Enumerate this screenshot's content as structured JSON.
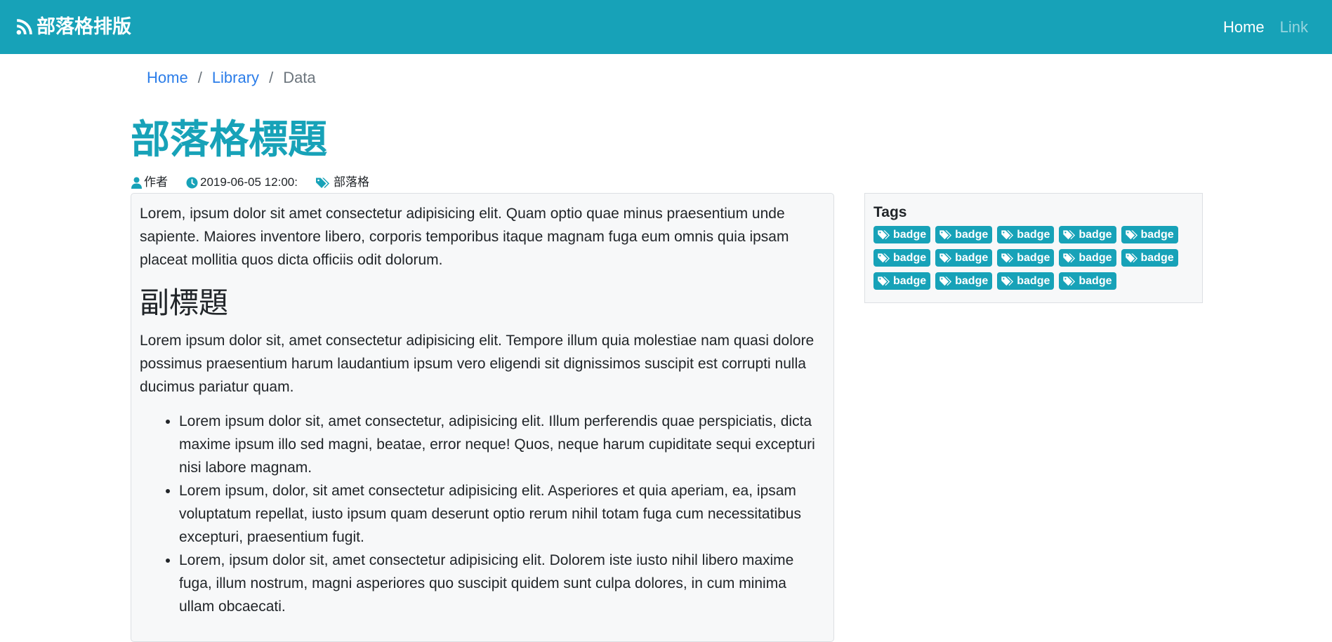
{
  "navbar": {
    "brand": "部落格排版",
    "brand_icon": "rss-icon",
    "links": [
      "Home",
      "Link"
    ],
    "bg_color": "#17a2b8"
  },
  "breadcrumb": {
    "items": [
      "Home",
      "Library"
    ],
    "active": "Data"
  },
  "post": {
    "title": "部落格標題",
    "author": "作者",
    "date": "2019-06-05 12:00:",
    "category": "部落格",
    "paragraph1": "Lorem, ipsum dolor sit amet consectetur adipisicing elit. Quam optio quae minus praesentium unde sapiente. Maiores inventore libero, corporis temporibus itaque magnam fuga eum omnis quia ipsam placeat mollitia quos dicta officiis odit dolorum.",
    "subtitle": "副標題",
    "paragraph2": "Lorem ipsum dolor sit, amet consectetur adipisicing elit. Tempore illum quia molestiae nam quasi dolore possimus praesentium harum laudantium ipsum vero eligendi sit dignissimos suscipit est corrupti nulla ducimus pariatur quam.",
    "list": [
      "Lorem ipsum dolor sit, amet consectetur, adipisicing elit. Illum perferendis quae perspiciatis, dicta maxime ipsum illo sed magni, beatae, error neque! Quos, neque harum cupiditate sequi excepturi nisi labore magnam.",
      "Lorem ipsum, dolor, sit amet consectetur adipisicing elit. Asperiores et quia aperiam, ea, ipsam voluptatum repellat, iusto ipsum quam deserunt optio rerum nihil totam fuga cum necessitatibus excepturi, praesentium fugit.",
      "Lorem, ipsum dolor sit, amet consectetur adipisicing elit. Dolorem iste iusto nihil libero maxime fuga, illum nostrum, magni asperiores quo suscipit quidem sunt culpa dolores, in cum minima ullam obcaecati."
    ]
  },
  "sidebar": {
    "tags_title": "Tags",
    "badges": [
      "badge",
      "badge",
      "badge",
      "badge",
      "badge",
      "badge",
      "badge",
      "badge",
      "badge",
      "badge",
      "badge",
      "badge",
      "badge",
      "badge"
    ]
  },
  "icons": {
    "author": "user-icon",
    "date": "clock-icon",
    "category": "tags-icon",
    "badge": "tags-icon"
  }
}
